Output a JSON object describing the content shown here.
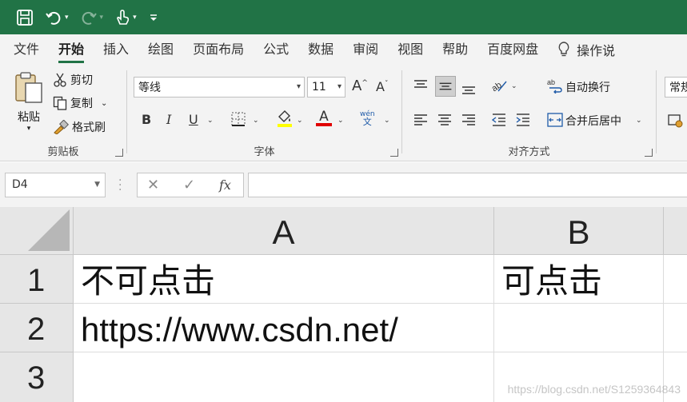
{
  "quick_access": {
    "items": [
      {
        "icon": "save-icon"
      },
      {
        "icon": "undo-icon"
      },
      {
        "icon": "redo-icon"
      },
      {
        "icon": "touch-mode-icon"
      },
      {
        "icon": "customize-qat-icon"
      }
    ]
  },
  "colors": {
    "brand": "#217346",
    "ribbon_bg": "#f3f3f3",
    "font_highlight": "#ffff00",
    "font_color": "#e00000"
  },
  "tabs": [
    "文件",
    "开始",
    "插入",
    "绘图",
    "页面布局",
    "公式",
    "数据",
    "审阅",
    "视图",
    "帮助",
    "百度网盘"
  ],
  "active_tab": "开始",
  "tell_me": "操作说",
  "ribbon": {
    "clipboard": {
      "paste": "粘贴",
      "cut": "剪切",
      "copy": "复制",
      "format_painter": "格式刷",
      "label": "剪贴板"
    },
    "font": {
      "name": "等线",
      "size": "11",
      "grow": "A",
      "shrink": "A",
      "bold": "B",
      "italic": "I",
      "underline": "U",
      "fill_letter": "A",
      "color_letter": "A",
      "phonetic_top": "wén",
      "phonetic_bottom": "文",
      "label": "字体"
    },
    "alignment": {
      "wrap": "自动换行",
      "merge": "合并后居中",
      "label": "对齐方式"
    },
    "number": {
      "format": "常规"
    }
  },
  "formula_bar": {
    "name_box": "D4",
    "cancel": "✕",
    "enter": "✓",
    "fx": "fx",
    "content": ""
  },
  "sheet": {
    "columns": [
      "A",
      "B"
    ],
    "rows": [
      "1",
      "2",
      "3"
    ],
    "cells": {
      "A1": "不可点击",
      "B1": "可点击",
      "A2": "https://www.csdn.net/",
      "B2": "",
      "A3": "",
      "B3": ""
    }
  },
  "watermark": "https://blog.csdn.net/S1259364843"
}
